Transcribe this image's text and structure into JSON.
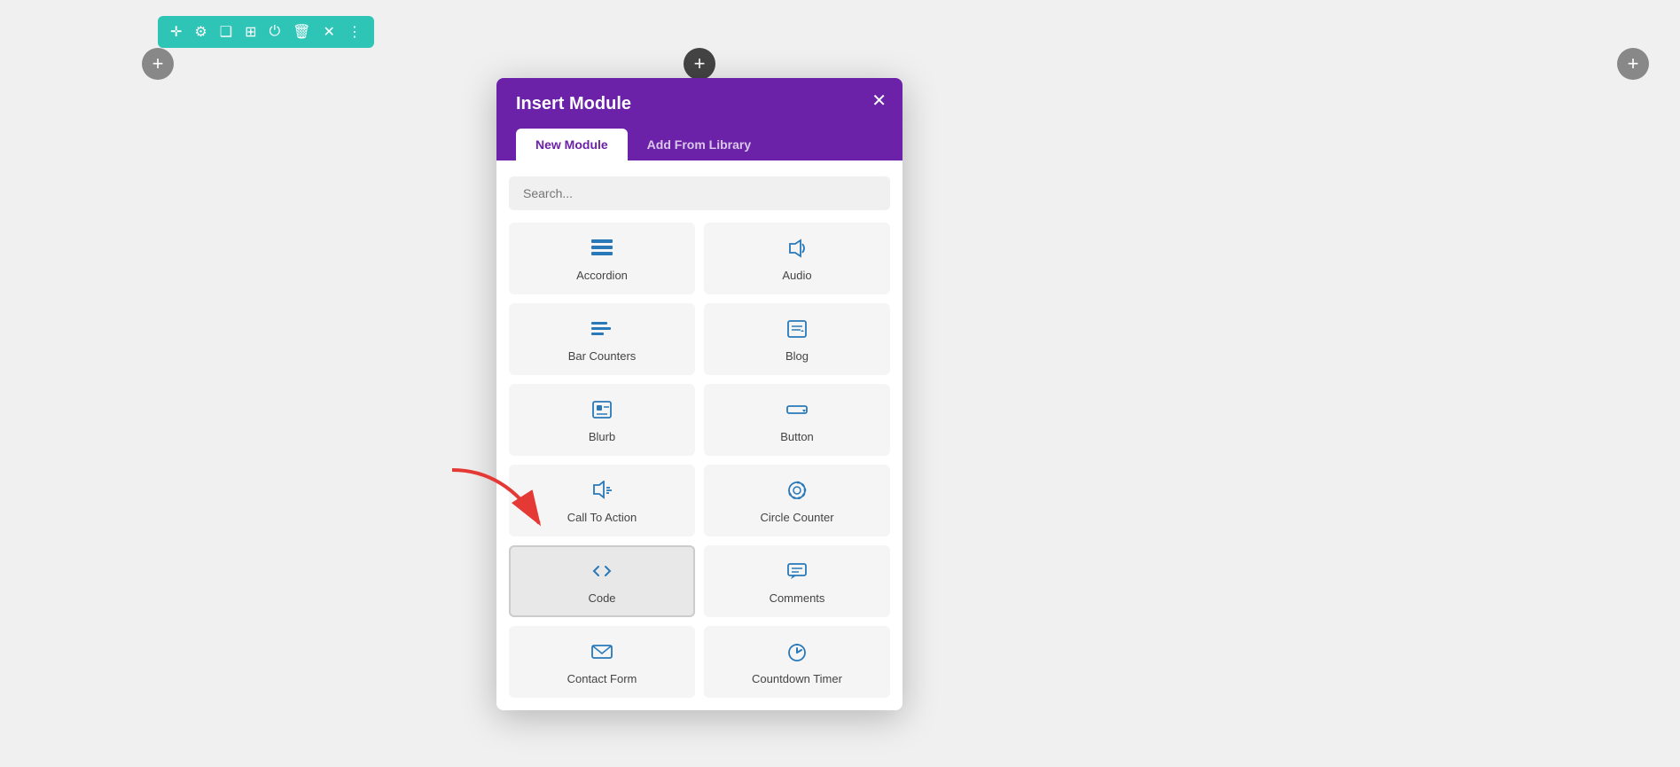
{
  "toolbar": {
    "icons": [
      "✛",
      "⚙",
      "▣",
      "▦",
      "⏻",
      "🗑",
      "✕",
      "⋮"
    ]
  },
  "plus_buttons": {
    "left_label": "+",
    "top_label": "+",
    "right_label": "+"
  },
  "modal": {
    "title": "Insert Module",
    "close_label": "✕",
    "tabs": [
      {
        "label": "New Module",
        "active": true
      },
      {
        "label": "Add From Library",
        "active": false
      }
    ],
    "search_placeholder": "Search...",
    "modules": [
      {
        "label": "Accordion",
        "icon": "≡"
      },
      {
        "label": "Audio",
        "icon": "🔊"
      },
      {
        "label": "Bar Counters",
        "icon": "≡"
      },
      {
        "label": "Blog",
        "icon": "✎"
      },
      {
        "label": "Blurb",
        "icon": "▣"
      },
      {
        "label": "Button",
        "icon": "▷"
      },
      {
        "label": "Call To Action",
        "icon": "🔊"
      },
      {
        "label": "Circle Counter",
        "icon": "◎"
      },
      {
        "label": "Code",
        "icon": "</>",
        "highlighted": true
      },
      {
        "label": "Comments",
        "icon": "💬"
      },
      {
        "label": "Contact Form",
        "icon": "✉"
      },
      {
        "label": "Countdown Timer",
        "icon": "⏱"
      }
    ]
  }
}
